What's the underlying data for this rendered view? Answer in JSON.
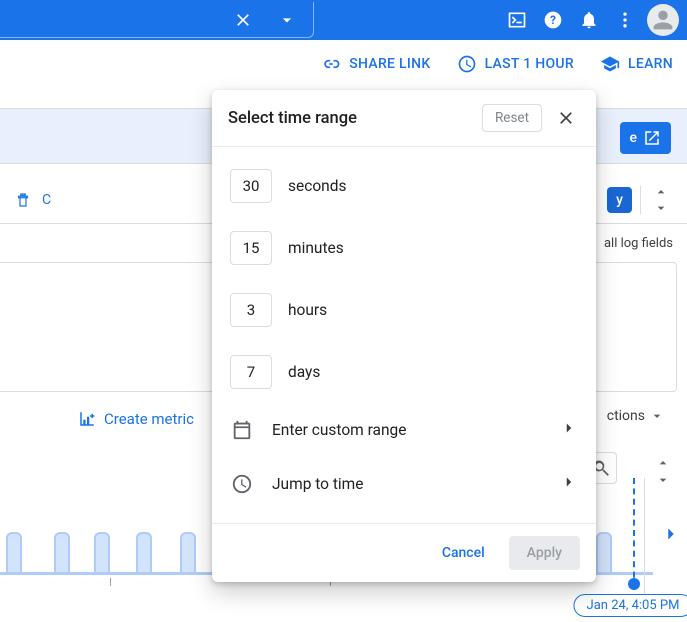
{
  "topbar": {
    "icons": [
      "close",
      "expand",
      "terminal",
      "help",
      "bell",
      "more",
      "avatar"
    ]
  },
  "actionrow": {
    "share": "SHARE LINK",
    "time": "LAST 1 HOUR",
    "learn": "LEARN"
  },
  "backdrop": {
    "open_suffix": "e",
    "clear_hint": "C",
    "badge": "y",
    "fields_label": "all log fields",
    "create_metric": "Create metric",
    "actions_suffix": "ctions"
  },
  "popover": {
    "title": "Select time range",
    "reset": "Reset",
    "presets": [
      {
        "value": "30",
        "unit": "seconds"
      },
      {
        "value": "15",
        "unit": "minutes"
      },
      {
        "value": "3",
        "unit": "hours"
      },
      {
        "value": "7",
        "unit": "days"
      }
    ],
    "custom": "Enter custom range",
    "jump": "Jump to time",
    "cancel": "Cancel",
    "apply": "Apply"
  },
  "timeline": {
    "now_label": "Jan 24, 4:05 PM"
  }
}
